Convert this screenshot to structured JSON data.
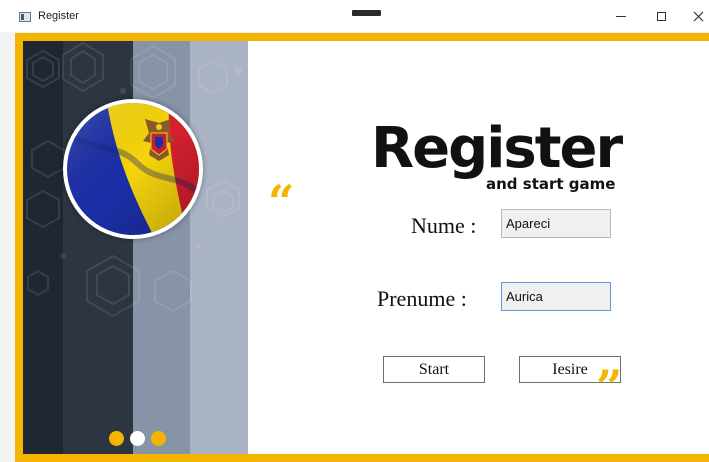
{
  "window": {
    "title": "Register",
    "controls": [
      "minimize",
      "maximize",
      "close"
    ]
  },
  "colors": {
    "accent": "#f4b400",
    "flag_blue": "#1c2fa8",
    "flag_yellow": "#f6d40c",
    "flag_red": "#d6202e",
    "panel_dark": "#1f2732",
    "panel_mid": "#2c3541",
    "panel_light": "#8793a6",
    "panel_lighter": "#aab3c4"
  },
  "branding": {
    "title": "Register",
    "subtitle": "and start game",
    "quote_open": "“",
    "quote_close": "”"
  },
  "form": {
    "nume_label": "Nume :",
    "nume_value": "Apareci",
    "prenume_label": "Prenume :",
    "prenume_value": "Aurica"
  },
  "buttons": {
    "start_label": "Start",
    "exit_label": "Iesire"
  },
  "carousel": {
    "count": 3,
    "active_index": 1
  }
}
